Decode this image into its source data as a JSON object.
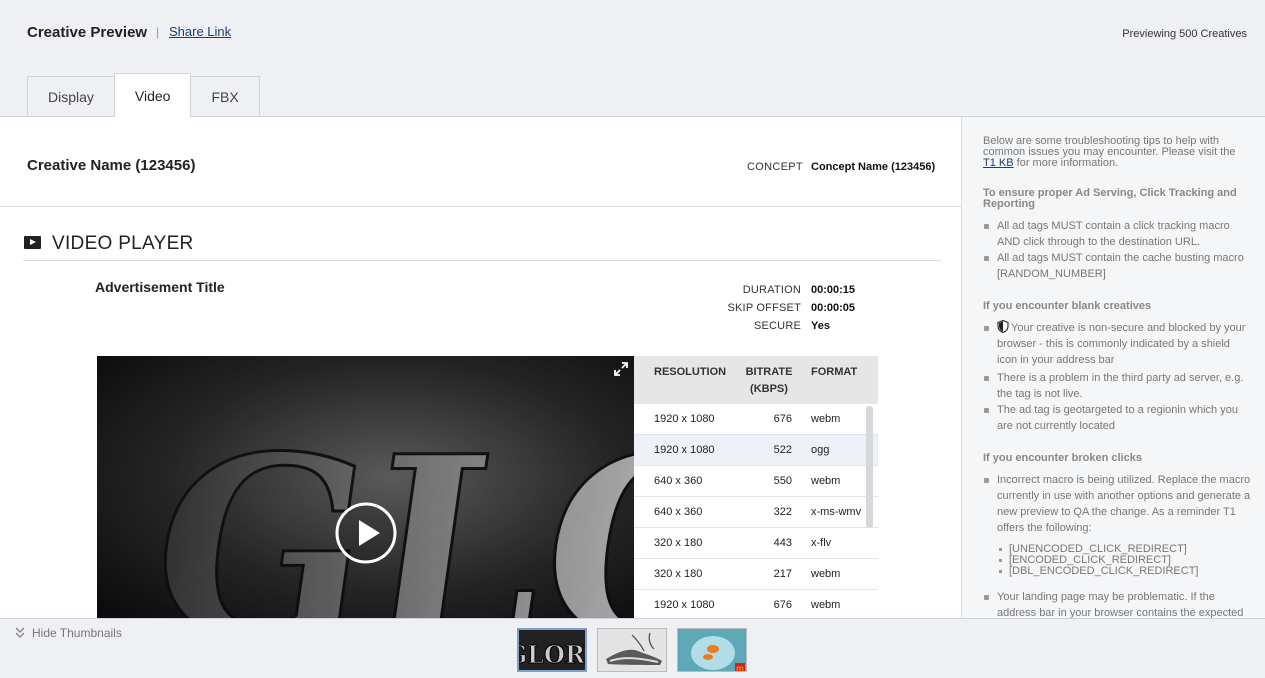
{
  "header": {
    "title": "Creative Preview",
    "separator": "|",
    "share_link": "Share Link",
    "preview_count": "Previewing 500 Creatives"
  },
  "tabs": [
    {
      "label": "Display",
      "active": false
    },
    {
      "label": "Video",
      "active": true
    },
    {
      "label": "FBX",
      "active": false
    }
  ],
  "creative": {
    "name": "Creative Name (123456)",
    "concept_label": "CONCEPT",
    "concept_value": "Concept Name (123456)"
  },
  "video_player": {
    "section_title": "VIDEO PLAYER",
    "ad_title": "Advertisement Title",
    "meta": [
      {
        "label": "DURATION",
        "value": "00:00:15"
      },
      {
        "label": "SKIP OFFSET",
        "value": "00:00:05"
      },
      {
        "label": "SECURE",
        "value": "Yes"
      }
    ],
    "poster_text": "GLORY",
    "renditions": {
      "headers": {
        "resolution": "RESOLUTION",
        "bitrate_line1": "BITRATE",
        "bitrate_line2": "(KBPS)",
        "format": "FORMAT"
      },
      "rows": [
        {
          "resolution": "1920 x 1080",
          "bitrate": "676",
          "format": "webm",
          "highlight": false
        },
        {
          "resolution": "1920 x 1080",
          "bitrate": "522",
          "format": "ogg",
          "highlight": true
        },
        {
          "resolution": "640 x 360",
          "bitrate": "550",
          "format": "webm",
          "highlight": false
        },
        {
          "resolution": "640 x 360",
          "bitrate": "322",
          "format": "x-ms-wmv",
          "highlight": false
        },
        {
          "resolution": "320 x 180",
          "bitrate": "443",
          "format": "x-flv",
          "highlight": false
        },
        {
          "resolution": "320 x 180",
          "bitrate": "217",
          "format": "webm",
          "highlight": false
        },
        {
          "resolution": "1920 x 1080",
          "bitrate": "676",
          "format": "webm",
          "highlight": false
        }
      ]
    }
  },
  "tips": {
    "intro_before": "Below are some troubleshooting tips to help with common issues you may encounter. Please visit the",
    "intro_link": "T1 KB",
    "intro_after": "for more information.",
    "section1_title": "To ensure proper Ad Serving, Click Tracking and Reporting",
    "section1_items": [
      "All ad tags MUST contain a click tracking macro AND click through to the destination URL.",
      "All ad tags MUST contain the cache busting macro [RANDOM_NUMBER]"
    ],
    "section2_title": "If you encounter blank creatives",
    "section2_items": [
      "Your creative is non-secure and blocked by your browser - this is commonly indicated by a shield icon in your address bar",
      "There is a problem in the third party ad server, e.g. the tag is not live.",
      "The ad tag is geotargeted to a regionin which you are not currently located"
    ],
    "section3_title": "If you encounter broken clicks",
    "section3_items": [
      "Incorrect macro is being utilized. Replace the macro currently in use with another options and generate a new preview to QA the change. As a reminder T1 offers the following:",
      "Your landing page may be problematic. If the address bar in your browser contains the expected"
    ],
    "macros": [
      "[UNENCODED_CLICK_REDIRECT]",
      "[ENCODED_CLICK_REDIRECT]",
      "[DBL_ENCODED_CLICK_REDIRECT]"
    ]
  },
  "bottom_bar": {
    "hide_thumbnails": "Hide Thumbnails",
    "thumbnails": [
      {
        "name": "glory",
        "active": true
      },
      {
        "name": "sneaker",
        "active": false
      },
      {
        "name": "fishbowl",
        "active": false
      }
    ]
  },
  "colors": {
    "link": "#1a3f72",
    "background": "#eef0f4",
    "active_thumb_border": "#7da0c8"
  }
}
